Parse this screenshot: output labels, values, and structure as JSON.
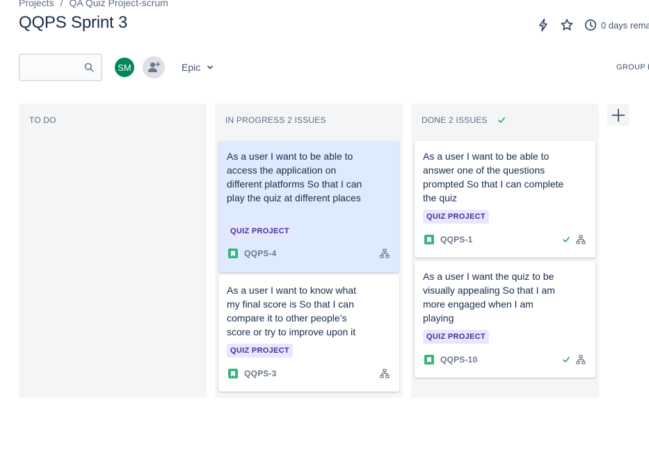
{
  "breadcrumb": {
    "projects": "Projects",
    "separator": "/",
    "project": "QA Quiz Project-scrum"
  },
  "page": {
    "title": "QQPS Sprint 3"
  },
  "actions": {
    "days_remaining": "0 days rema"
  },
  "search": {
    "value": "",
    "placeholder": ""
  },
  "avatars": {
    "user_initials": "SM"
  },
  "filters": {
    "epic_label": "Epic"
  },
  "group_by": {
    "label": "GROUP B"
  },
  "colors": {
    "story": "#36b37e",
    "epic_bg": "#eae6ff",
    "epic_text": "#403294",
    "done_check": "#36b37e",
    "selected_card": "#deebff",
    "avatar": "#00875a"
  },
  "columns": [
    {
      "title": "TO DO",
      "cards": []
    },
    {
      "title": "IN PROGRESS 2 ISSUES",
      "cards": [
        {
          "summary": "As a user I want to be able to access the application on different platforms So that I can play the quiz at different places",
          "epic": "QUIZ PROJECT",
          "key": "QQPS-4",
          "type_icon": "story-icon",
          "done": false,
          "selected": true
        },
        {
          "summary": "As a user I want to know what my final score is So that I can compare it to other people’s score or try to improve upon it",
          "epic": "QUIZ PROJECT",
          "key": "QQPS-3",
          "type_icon": "story-icon",
          "done": false,
          "selected": false
        }
      ]
    },
    {
      "title": "DONE 2 ISSUES",
      "cards": [
        {
          "summary": "As a user I want to be able to answer one of the questions prompted So that I can complete the quiz",
          "epic": "QUIZ PROJECT",
          "key": "QQPS-1",
          "type_icon": "story-icon",
          "done": true,
          "selected": false
        },
        {
          "summary": "As a user I want the quiz to be visually appealing So that I am more engaged when I am playing",
          "epic": "QUIZ PROJECT",
          "key": "QQPS-10",
          "type_icon": "story-icon",
          "done": true,
          "selected": false
        }
      ]
    }
  ]
}
